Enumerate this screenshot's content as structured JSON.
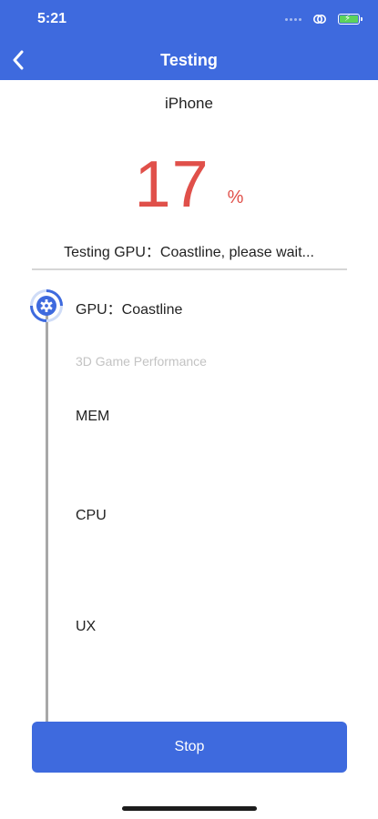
{
  "status_bar": {
    "time": "5:21"
  },
  "nav": {
    "title": "Testing"
  },
  "device": {
    "name": "iPhone"
  },
  "progress": {
    "value": "17",
    "unit": "%"
  },
  "status_message": "Testing GPU：Coastline, please wait...",
  "steps": [
    {
      "title": "GPU：Coastline",
      "subtitle": "3D Game Performance",
      "state": "active"
    },
    {
      "title": "MEM",
      "state": "pending"
    },
    {
      "title": "CPU",
      "state": "pending"
    },
    {
      "title": "UX",
      "state": "pending"
    }
  ],
  "actions": {
    "stop_label": "Stop"
  },
  "colors": {
    "primary": "#3e6ade",
    "progress": "#e0504a",
    "battery": "#5cd35c"
  },
  "icons": {
    "back": "chevron-left-icon",
    "active_step": "gear-icon"
  }
}
